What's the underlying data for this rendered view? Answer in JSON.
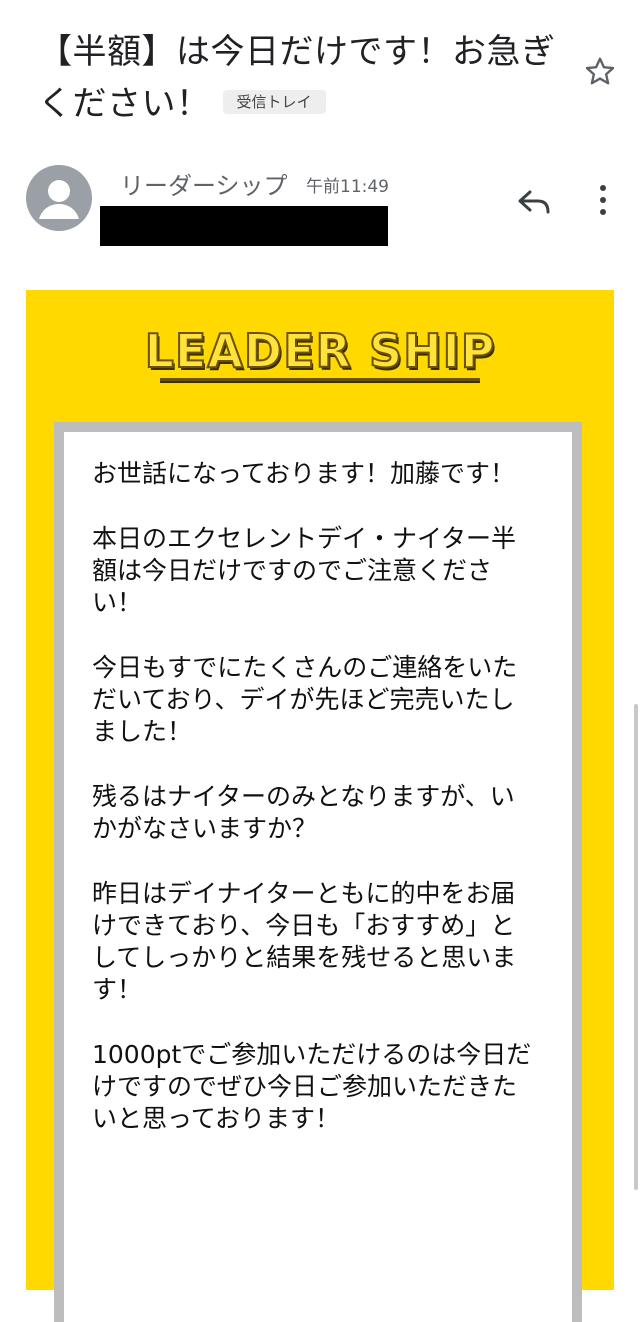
{
  "email": {
    "subject": "【半額】は今日だけです！お急ぎください！",
    "label": "受信トレイ",
    "sender_name": "リーダーシップ",
    "time": "午前11:49"
  },
  "icons": {
    "star": "star-outline-icon",
    "avatar": "person-icon",
    "reply": "reply-icon",
    "more": "more-vert-icon"
  },
  "banner": {
    "logo_text": "LEADER SHIP",
    "bg_color": "#ffd900",
    "card_border_color": "#bdbdbd"
  },
  "body": {
    "paragraphs": [
      "お世話になっております！加藤です！",
      "本日のエクセレントデイ・ナイター半額は今日だけですのでご注意ください！",
      "今日もすでにたくさんのご連絡をいただいており、デイが先ほど完売いたしました！",
      "残るはナイターのみとなりますが、いかがなさいますか？",
      "昨日はデイナイターともに的中をお届けできており、今日も「おすすめ」としてしっかりと結果を残せると思います！",
      "1000ptでご参加いただけるのは今日だけですのでぜひ今日ご参加いただきたいと思っております！"
    ]
  }
}
